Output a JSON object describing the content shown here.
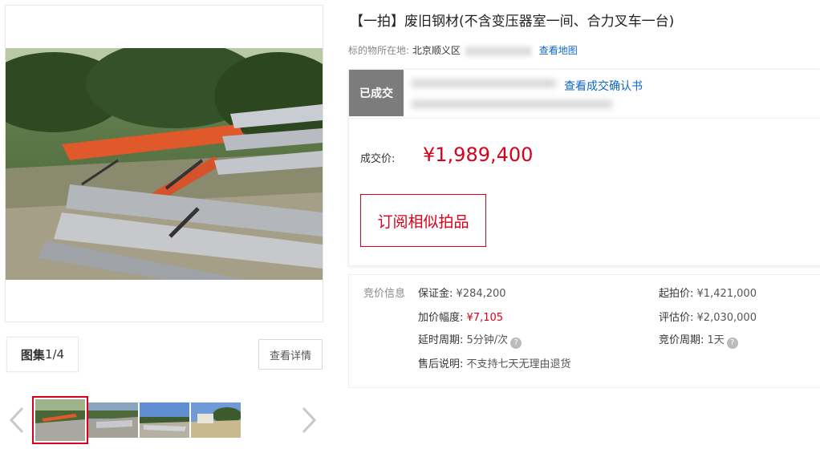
{
  "gallery": {
    "label_prefix": "图集",
    "counter": "1/4",
    "detail_button": "查看详情",
    "thumbnails": [
      "thumbnail-1",
      "thumbnail-2",
      "thumbnail-3",
      "thumbnail-4"
    ],
    "icons": {
      "prev": "chevron-left-icon",
      "next": "chevron-right-icon"
    }
  },
  "item": {
    "title": "【一拍】废旧钢材(不含变压器室一间、合力叉车一台)",
    "location_label": "标的物所在地:",
    "location_value": "北京顺义区",
    "map_link": "查看地图"
  },
  "result": {
    "status": "已成交",
    "confirm_link": "查看成交确认书",
    "price_label": "成交价:",
    "price_value": "¥1,989,400",
    "subscribe_button": "订阅相似拍品"
  },
  "bid_info": {
    "title": "竞价信息",
    "deposit_label": "保证金:",
    "deposit_value": "¥284,200",
    "start_label": "起拍价:",
    "start_value": "¥1,421,000",
    "increment_label": "加价幅度:",
    "increment_value": "¥7,105",
    "assess_label": "评估价:",
    "assess_value": "¥2,030,000",
    "delay_label": "延时周期:",
    "delay_value": "5分钟/次",
    "cycle_label": "竞价周期:",
    "cycle_value": "1天",
    "aftersale_label": "售后说明:",
    "aftersale_value": "不支持七天无理由退货",
    "help_glyph": "?"
  },
  "colors": {
    "accent": "#d9001b",
    "link": "#0d65c9",
    "badge": "#7c7c7c"
  }
}
